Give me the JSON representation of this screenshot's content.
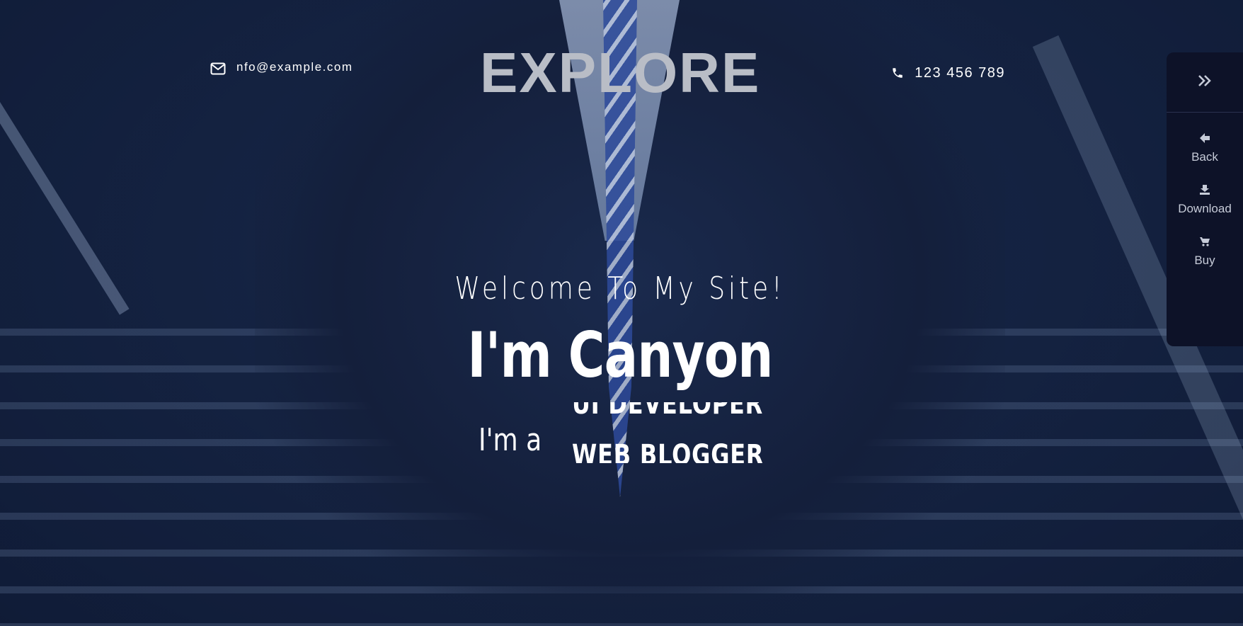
{
  "header": {
    "logo": "EXPLORE",
    "email": "nfo@example.com",
    "phone": "123 456 789",
    "email_icon": "envelope-icon",
    "phone_icon": "phone-icon"
  },
  "side_panel": {
    "toggle_icon": "double-chevron-right-icon",
    "items": [
      {
        "label": "Back",
        "icon": "arrow-left-icon"
      },
      {
        "label": "Download",
        "icon": "download-icon"
      },
      {
        "label": "Buy",
        "icon": "cart-icon"
      }
    ]
  },
  "hero": {
    "welcome": "Welcome To My Site!",
    "name": "I'm Canyon",
    "role_prefix": "I'm a",
    "roles": [
      "UI DEVELOPER",
      "WEB BLOGGER"
    ]
  },
  "colors": {
    "overlay": "#121e3c",
    "panel": "#0d1228",
    "text": "#ffffff",
    "logo": "#b9bdc6"
  }
}
